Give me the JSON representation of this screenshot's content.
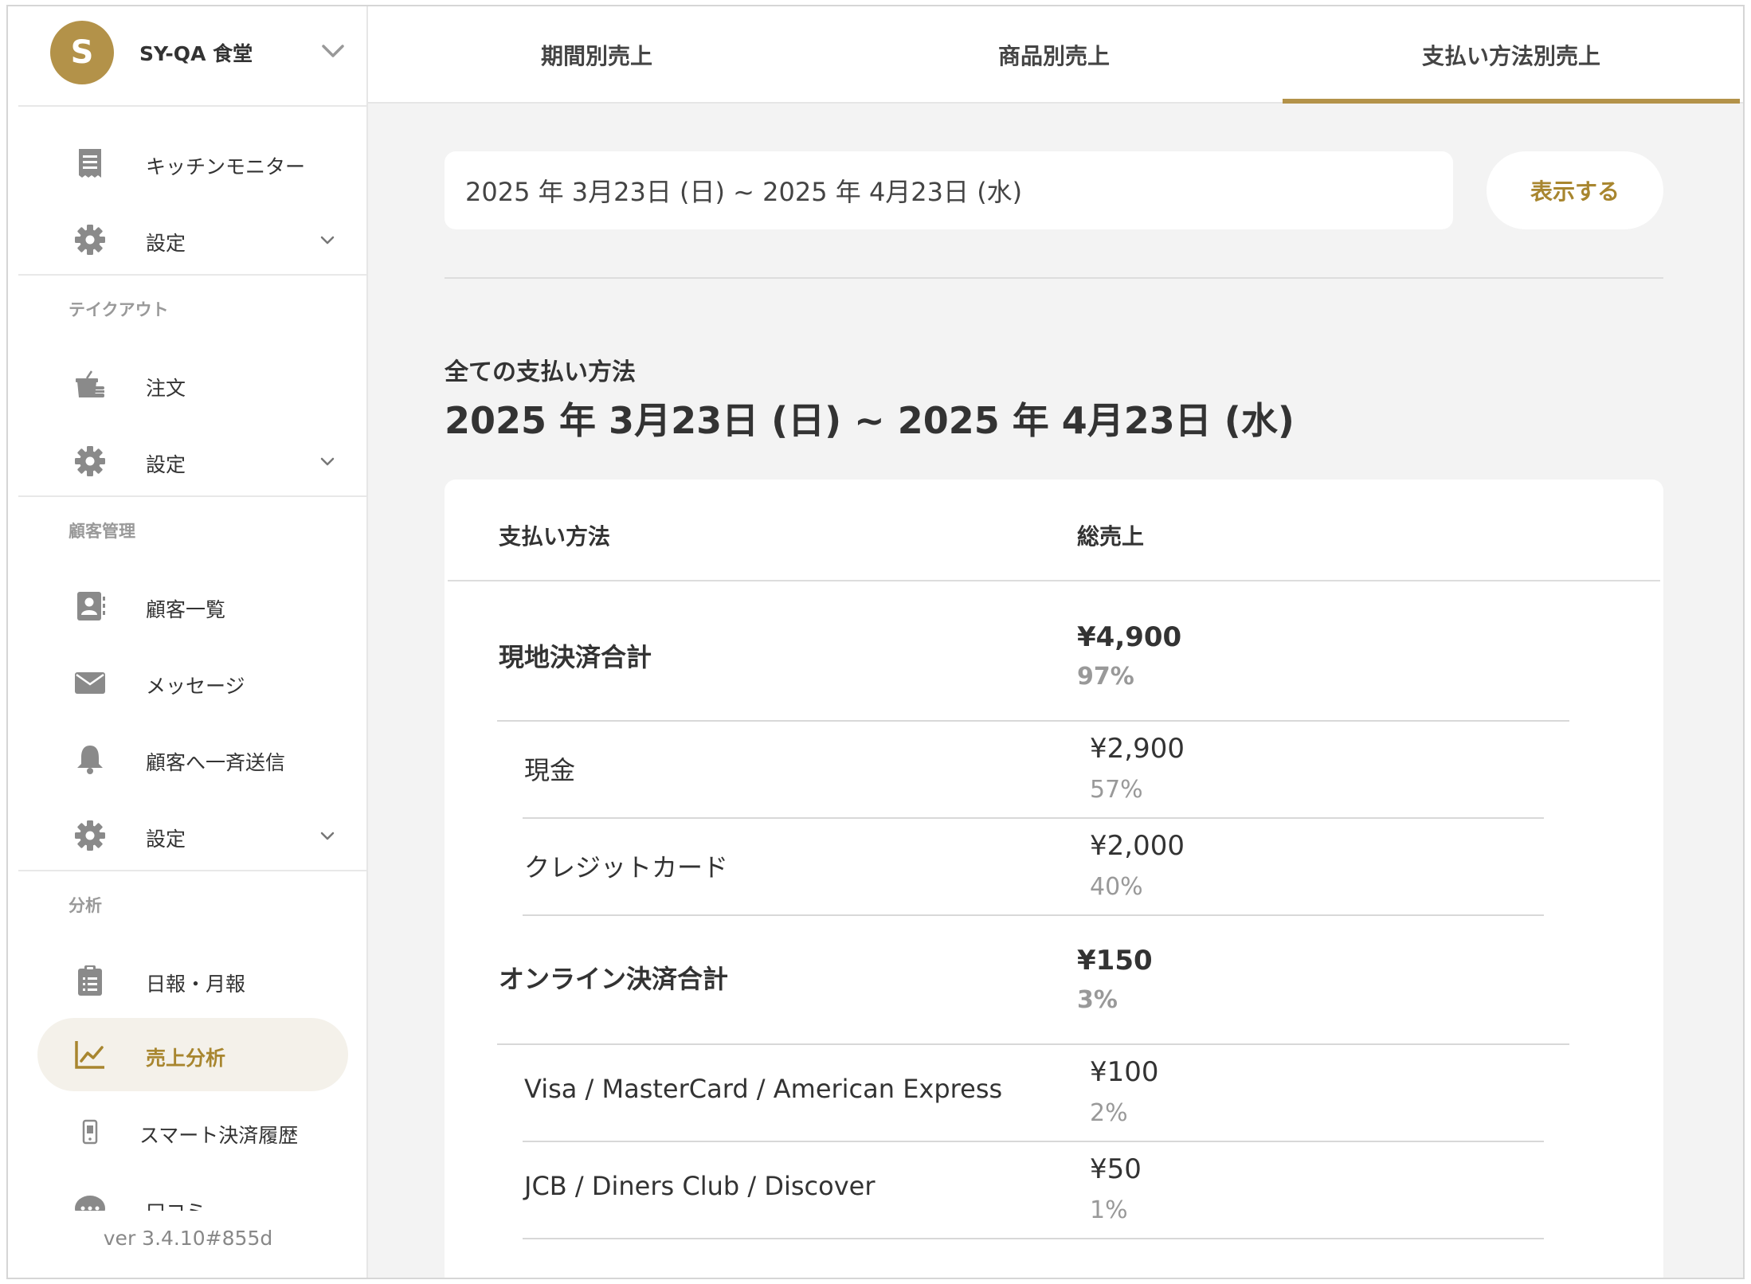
{
  "store": {
    "avatar_letter": "S",
    "name": "SY-QA 食堂"
  },
  "sidebar": {
    "group_main": [
      {
        "label": "キッチンモニター",
        "icon": "receipt-icon"
      },
      {
        "label": "設定",
        "icon": "gear-icon"
      }
    ],
    "section_takeout": "テイクアウト",
    "group_takeout": [
      {
        "label": "注文",
        "icon": "takeout-icon"
      },
      {
        "label": "設定",
        "icon": "gear-icon"
      }
    ],
    "section_customers": "顧客管理",
    "group_customers": [
      {
        "label": "顧客一覧",
        "icon": "contact-card-icon"
      },
      {
        "label": "メッセージ",
        "icon": "envelope-icon"
      },
      {
        "label": "顧客へ一斉送信",
        "icon": "bell-icon"
      },
      {
        "label": "設定",
        "icon": "gear-icon"
      }
    ],
    "section_analytics": "分析",
    "group_analytics": [
      {
        "label": "日報・月報",
        "icon": "clipboard-icon"
      },
      {
        "label": "売上分析",
        "icon": "line-chart-icon"
      },
      {
        "label": "スマート決済履歴",
        "icon": "phone-icon"
      },
      {
        "label": "口コミ",
        "icon": "chat-icon"
      }
    ],
    "version": "ver 3.4.10#855d"
  },
  "tabs": [
    {
      "label": "期間別売上"
    },
    {
      "label": "商品別売上"
    },
    {
      "label": "支払い方法別売上"
    }
  ],
  "filter": {
    "date_range": "2025 年 3月23日 (日) ~ 2025 年 4月23日 (水)",
    "show_label": "表示する"
  },
  "summary": {
    "title": "全ての支払い方法",
    "range": "2025 年 3月23日 (日) ~ 2025 年 4月23日 (水)"
  },
  "table": {
    "headers": {
      "method": "支払い方法",
      "total": "総売上"
    },
    "rows": [
      {
        "name": "現地決済合計",
        "amount": "¥4,900",
        "percent": "97%"
      },
      {
        "name": "現金",
        "amount": "¥2,900",
        "percent": "57%"
      },
      {
        "name": "クレジットカード",
        "amount": "¥2,000",
        "percent": "40%"
      },
      {
        "name": "オンライン決済合計",
        "amount": "¥150",
        "percent": "3%"
      },
      {
        "name": "Visa / MasterCard / American Express",
        "amount": "¥100",
        "percent": "2%"
      },
      {
        "name": "JCB / Diners Club / Discover",
        "amount": "¥50",
        "percent": "1%"
      }
    ]
  },
  "colors": {
    "accent": "#b39249",
    "accent_text": "#a8862f",
    "icon_gray": "#8a8a8a",
    "background": "#f3f3f3"
  }
}
